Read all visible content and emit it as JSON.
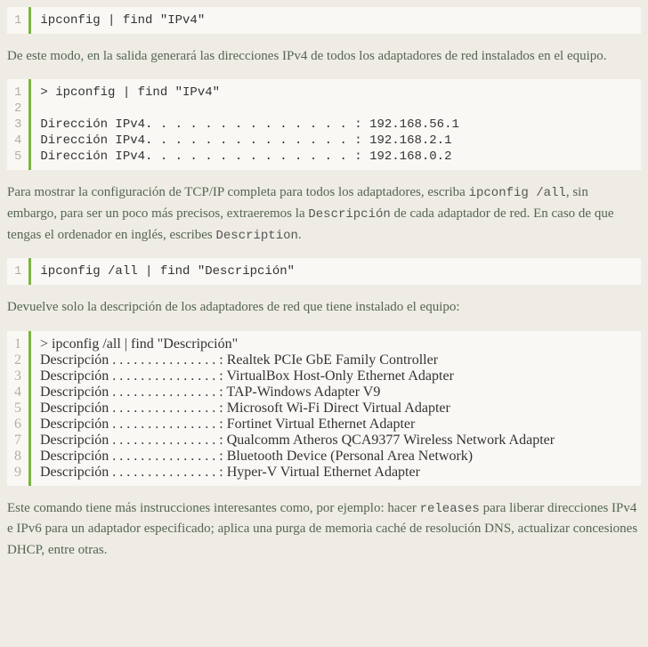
{
  "block1": {
    "lines": [
      "ipconfig | find \"IPv4\""
    ]
  },
  "para1_a": "De este modo, en la salida generará las direcciones IPv4 de todos los adaptadores de red instalados en el equipo.",
  "block2": {
    "lines": [
      "> ipconfig | find \"IPv4\"",
      "",
      "Dirección IPv4. . . . . . . . . . . . . . : 192.168.56.1",
      "Dirección IPv4. . . . . . . . . . . . . . : 192.168.2.1",
      "Dirección IPv4. . . . . . . . . . . . . . : 192.168.0.2"
    ]
  },
  "para2_a": "Para mostrar la configuración de TCP/IP completa para todos los adaptadores, escriba ",
  "para2_code1": "ipconfig /all",
  "para2_b": ", sin embargo, para ser un poco más precisos, extraeremos la ",
  "para2_code2": "Descripción",
  "para2_c": " de cada adaptador de red. En caso de que tengas el ordenador en inglés, escribes ",
  "para2_code3": "Description",
  "para2_d": ".",
  "block3": {
    "lines": [
      "ipconfig /all | find \"Descripción\""
    ]
  },
  "para3": "Devuelve solo la descripción de los adaptadores de red que tiene instalado el equipo:",
  "block4": {
    "lines": [
      "> ipconfig /all | find \"Descripción\"",
      "Descripción . . . . . . . . . . . . . . . : Realtek PCIe GbE Family Controller",
      "Descripción . . . . . . . . . . . . . . . : VirtualBox Host-Only Ethernet Adapter",
      "Descripción . . . . . . . . . . . . . . . : TAP-Windows Adapter V9",
      "Descripción . . . . . . . . . . . . . . . : Microsoft Wi-Fi Direct Virtual Adapter",
      "Descripción . . . . . . . . . . . . . . . : Fortinet Virtual Ethernet Adapter",
      "Descripción . . . . . . . . . . . . . . . : Qualcomm Atheros QCA9377 Wireless Network Adapter",
      "Descripción . . . . . . . . . . . . . . . : Bluetooth Device (Personal Area Network)",
      "Descripción . . . . . . . . . . . . . . . : Hyper-V Virtual Ethernet Adapter"
    ]
  },
  "para4_a": "Este comando tiene más instrucciones interesantes como, por ejemplo: hacer ",
  "para4_code1": "releases",
  "para4_b": " para liberar direcciones IPv4 e IPv6 para un adaptador especificado; aplica una purga de memoria caché de resolución DNS, actualizar concesiones DHCP, entre otras."
}
